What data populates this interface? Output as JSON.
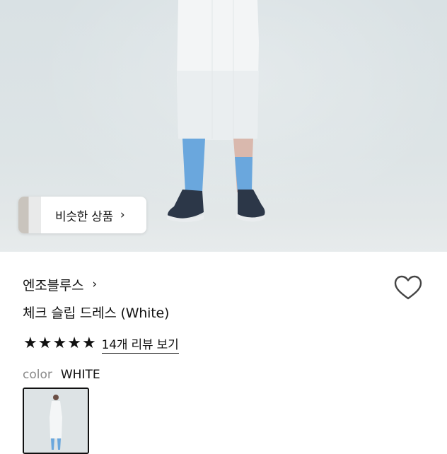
{
  "similar_products": {
    "label": "비슷한 상품",
    "chevron_icon": "chevron-right-icon"
  },
  "product": {
    "brand": "엔조블루스",
    "brand_chevron_icon": "chevron-right-icon",
    "name": "체크 슬립 드레스 (White)",
    "wishlist_icon": "heart-outline-icon",
    "rating": {
      "stars_filled": 5,
      "stars_total": 5,
      "reviews_label": "14개 리뷰 보기"
    },
    "color": {
      "key": "color",
      "value": "WHITE"
    }
  },
  "colors": {
    "text": "#111111",
    "muted": "#8a8a8a",
    "photo_bg": "#dde4e6",
    "sock_blue": "#6aa7dd"
  }
}
